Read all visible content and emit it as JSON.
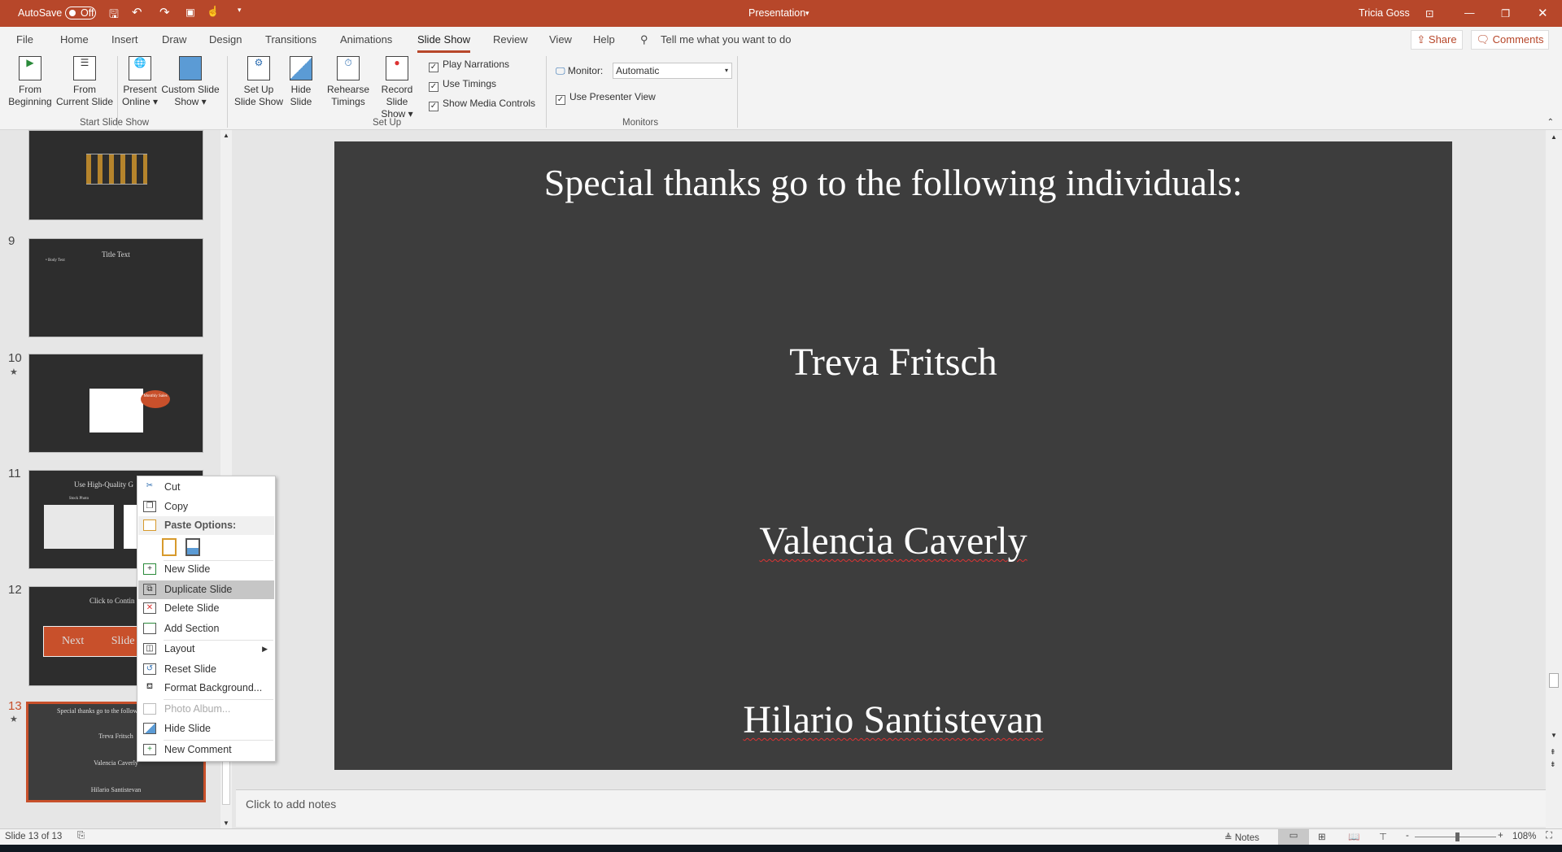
{
  "titlebar": {
    "autosave_label": "AutoSave",
    "autosave_state": "Off",
    "doc_title": "Presentation",
    "user": "Tricia Goss"
  },
  "tabs": [
    "File",
    "Home",
    "Insert",
    "Draw",
    "Design",
    "Transitions",
    "Animations",
    "Slide Show",
    "Review",
    "View",
    "Help"
  ],
  "active_tab": "Slide Show",
  "tell_me": "Tell me what you want to do",
  "share": "Share",
  "comments": "Comments",
  "ribbon": {
    "from_beginning": [
      "From",
      "Beginning"
    ],
    "from_current": [
      "From",
      "Current Slide"
    ],
    "present_online": [
      "Present",
      "Online ▾"
    ],
    "custom_show": [
      "Custom Slide",
      "Show ▾"
    ],
    "group_start": "Start Slide Show",
    "setup_show": [
      "Set Up",
      "Slide Show"
    ],
    "hide_slide": [
      "Hide",
      "Slide"
    ],
    "rehearse": [
      "Rehearse",
      "Timings"
    ],
    "record": [
      "Record Slide",
      "Show ▾"
    ],
    "play_narrations": "Play Narrations",
    "use_timings": "Use Timings",
    "show_media": "Show Media Controls",
    "group_setup": "Set Up",
    "monitor_label": "Monitor:",
    "monitor_value": "Automatic",
    "presenter_view": "Use Presenter View",
    "group_monitors": "Monitors"
  },
  "thumbs": {
    "n9": "9",
    "n10": "10",
    "n11": "11",
    "n12": "12",
    "n13": "13",
    "s9_title": "Title Text",
    "s9_body": "• Body Text",
    "s10_callout": "Monthly Sales",
    "s11_title": "Use High-Quality G",
    "s11_caption": "Stock Photo",
    "s12_title": "Click to Contin",
    "s12_next": "Next",
    "s12_slide": "Slide",
    "s13_title": "Special thanks go to the follow",
    "s13_n1": "Treva Fritsch",
    "s13_n2": "Valencia Caverly",
    "s13_n3": "Hilario Santistevan"
  },
  "slide": {
    "title": "Special thanks go to the following individuals:",
    "names": [
      "Treva Fritsch",
      "Valencia Caverly",
      "Hilario Santistevan"
    ]
  },
  "notes_placeholder": "Click to add notes",
  "context_menu": {
    "cut": "Cut",
    "copy": "Copy",
    "paste_options": "Paste Options:",
    "new_slide": "New Slide",
    "duplicate": "Duplicate Slide",
    "delete": "Delete Slide",
    "add_section": "Add Section",
    "layout": "Layout",
    "reset": "Reset Slide",
    "format_bg": "Format Background...",
    "photo_album": "Photo Album...",
    "hide": "Hide Slide",
    "new_comment": "New Comment"
  },
  "status": {
    "slide_count": "Slide 13 of 13",
    "notes": "Notes",
    "zoom": "108%",
    "zoom_level_percent": 108
  },
  "colors": {
    "accent": "#b7472a",
    "slide_bg": "#3d3d3d"
  }
}
